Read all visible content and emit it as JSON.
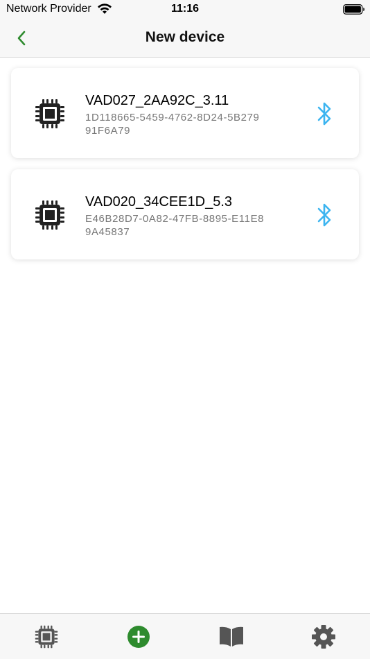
{
  "status_bar": {
    "carrier": "Network Provider",
    "time": "11:16"
  },
  "nav": {
    "title": "New device",
    "back_icon": "chevron-left-icon"
  },
  "devices": [
    {
      "name": "VAD027_2AA92C_3.11",
      "uuid": "1D118665-5459-4762-8D24-5B27991F6A79",
      "icon": "chip-icon",
      "status_icon": "bluetooth-icon"
    },
    {
      "name": "VAD020_34CEE1D_5.3",
      "uuid": "E46B28D7-0A82-47FB-8895-E11E89A45837",
      "icon": "chip-icon",
      "status_icon": "bluetooth-icon"
    }
  ],
  "tab_bar": {
    "tabs": [
      {
        "icon": "chip-icon"
      },
      {
        "icon": "add-circle-icon"
      },
      {
        "icon": "book-icon"
      },
      {
        "icon": "gear-icon"
      }
    ]
  },
  "colors": {
    "accent_green": "#2e8b2e",
    "bluetooth_blue": "#3cb4f0",
    "icon_dark": "#222222",
    "icon_gray": "#555555"
  }
}
